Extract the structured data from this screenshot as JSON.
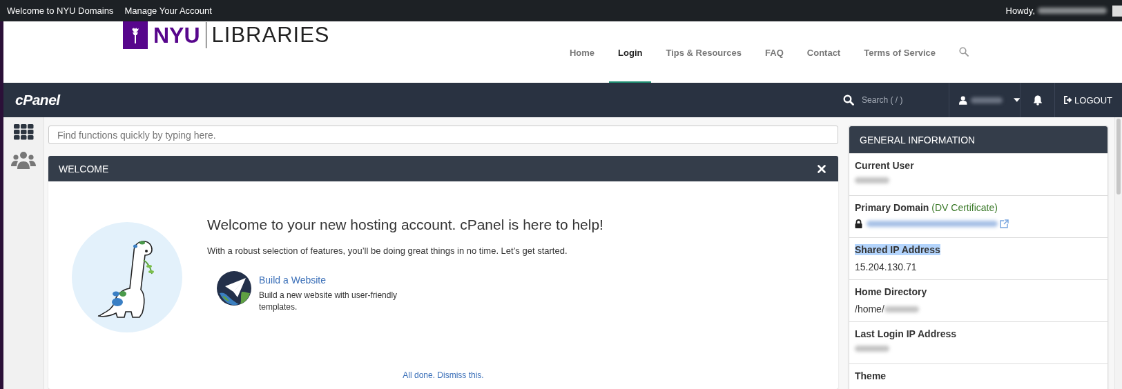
{
  "top_bar": {
    "links": [
      "Welcome to NYU Domains",
      "Manage Your Account"
    ],
    "greeting": "Howdy,",
    "name_redacted": true
  },
  "site_header": {
    "logo": {
      "mark": "NYU",
      "text": "LIBRARIES"
    },
    "nav": [
      {
        "label": "Home",
        "selected": false
      },
      {
        "label": "Login",
        "selected": true
      },
      {
        "label": "Tips & Resources",
        "selected": false
      },
      {
        "label": "FAQ",
        "selected": false
      },
      {
        "label": "Contact",
        "selected": false
      },
      {
        "label": "Terms of Service",
        "selected": false
      }
    ]
  },
  "cpanel_bar": {
    "logo": "cPanel",
    "search": {
      "placeholder": "Search ( / )"
    },
    "user_redacted": true,
    "logout": "LOGOUT"
  },
  "function_search": {
    "placeholder": "Find functions quickly by typing here."
  },
  "welcome_panel": {
    "title": "WELCOME",
    "heading": "Welcome to your new hosting account. cPanel is here to help!",
    "intro": "With a robust selection of features, you’ll be doing great things in no time. Let’s get started.",
    "actions": [
      {
        "title": "Build a Website",
        "description": "Build a new website with user-friendly templates."
      }
    ],
    "dismiss": "All done. Dismiss this."
  },
  "general_information": {
    "title": "GENERAL INFORMATION",
    "rows": [
      {
        "kind": "text",
        "label": "Current User",
        "highlighted": false,
        "redacted": true
      },
      {
        "kind": "domain",
        "label": "Primary Domain",
        "note": "(DV Certificate)",
        "highlighted": false,
        "redacted": true
      },
      {
        "kind": "text",
        "label": "Shared IP Address",
        "value": "15.204.130.71",
        "highlighted": true,
        "redacted": false
      },
      {
        "kind": "text",
        "label": "Home Directory",
        "value": "/home/",
        "highlighted": false,
        "redacted": true
      },
      {
        "kind": "text",
        "label": "Last Login IP Address",
        "highlighted": false,
        "redacted": true
      },
      {
        "kind": "text",
        "label": "Theme",
        "highlighted": false,
        "redacted": false
      }
    ]
  }
}
